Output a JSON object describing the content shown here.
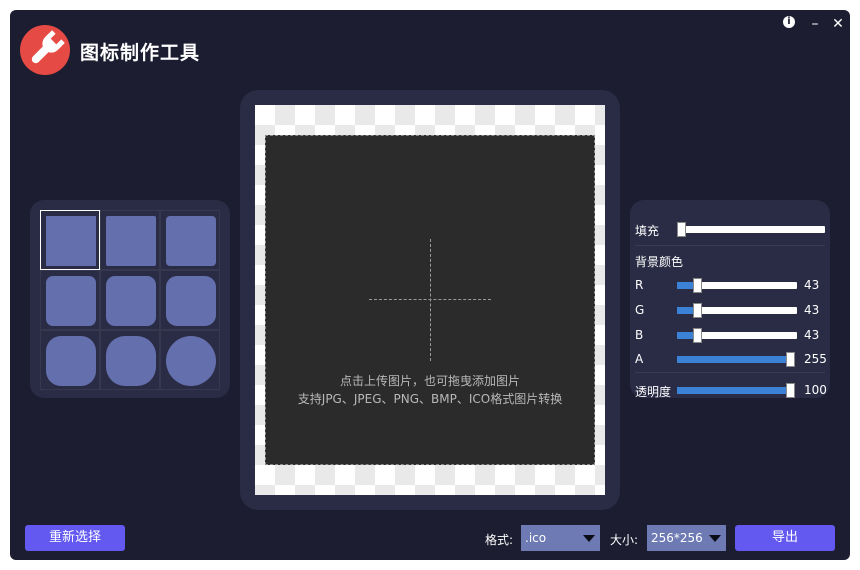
{
  "app": {
    "title": "图标制作工具"
  },
  "window_controls": {
    "info": "i",
    "minimize": "–",
    "close": "✕"
  },
  "canvas": {
    "hint_line1": "点击上传图片，也可拖曳添加图片",
    "hint_line2": "支持JPG、JPEG、PNG、BMP、ICO格式图片转换"
  },
  "presets": {
    "selected_index": 0,
    "corner_radius_percent": [
      0,
      4,
      8,
      14,
      18,
      22,
      30,
      38,
      50
    ]
  },
  "settings": {
    "fill": {
      "label": "填充",
      "value_fraction": 0.0
    },
    "bg_color_label": "背景颜色",
    "channels": [
      {
        "label": "R",
        "value": "43",
        "fraction": 0.169
      },
      {
        "label": "G",
        "value": "43",
        "fraction": 0.169
      },
      {
        "label": "B",
        "value": "43",
        "fraction": 0.169
      },
      {
        "label": "A",
        "value": "255",
        "fraction": 1.0
      }
    ],
    "opacity": {
      "label": "透明度",
      "value": "100",
      "fraction": 1.0
    }
  },
  "bottom": {
    "reselect_label": "重新选择",
    "format_label": "格式:",
    "format_value": ".ico",
    "size_label": "大小:",
    "size_value": "256*256",
    "export_label": "导出"
  },
  "colors": {
    "accent": "#6359f1",
    "slider_fill": "#3b82d6",
    "logo": "#e64a45",
    "shape": "#6470ad"
  }
}
